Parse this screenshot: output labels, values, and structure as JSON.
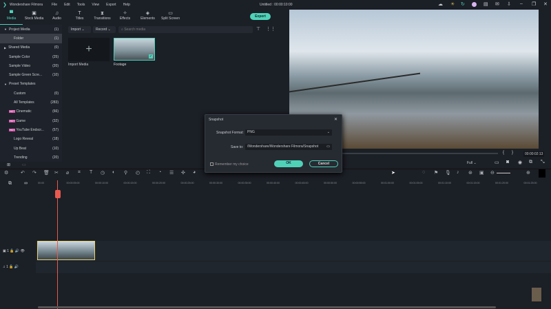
{
  "app": {
    "title": "Wondershare Filmora",
    "menu": [
      "File",
      "Edit",
      "Tools",
      "View",
      "Export",
      "Help"
    ],
    "project": "Untitled : 00:00:10:00"
  },
  "tabs": [
    {
      "label": "Media",
      "icon": "▀"
    },
    {
      "label": "Stock Media",
      "icon": "▣"
    },
    {
      "label": "Audio",
      "icon": "♫"
    },
    {
      "label": "Titles",
      "icon": "T"
    },
    {
      "label": "Transitions",
      "icon": "⧗"
    },
    {
      "label": "Effects",
      "icon": "✧"
    },
    {
      "label": "Elements",
      "icon": "◈"
    },
    {
      "label": "Split Screen",
      "icon": "▭"
    }
  ],
  "export_label": "Export",
  "sidebar": [
    {
      "label": "Project Media",
      "count": "(1)",
      "arrow": "▼",
      "indent": 0
    },
    {
      "label": "Folder",
      "count": "(1)",
      "arrow": "",
      "indent": 2,
      "sel": true
    },
    {
      "label": "Shared Media",
      "count": "(0)",
      "arrow": "▶",
      "indent": 0
    },
    {
      "label": "Sample Color",
      "count": "(25)",
      "arrow": "",
      "indent": 1
    },
    {
      "label": "Sample Video",
      "count": "(20)",
      "arrow": "",
      "indent": 1
    },
    {
      "label": "Sample Green Scre...",
      "count": "(10)",
      "arrow": "",
      "indent": 1
    },
    {
      "label": "Preset Templates",
      "count": "",
      "arrow": "▼",
      "indent": 0
    },
    {
      "label": "Custom",
      "count": "(0)",
      "arrow": "",
      "indent": 2
    },
    {
      "label": "All Templates",
      "count": "(283)",
      "arrow": "",
      "indent": 2
    },
    {
      "label": "Cinematic",
      "count": "(66)",
      "arrow": "",
      "indent": 1,
      "hot": true
    },
    {
      "label": "Game",
      "count": "(32)",
      "arrow": "",
      "indent": 1,
      "hot": true
    },
    {
      "label": "YouTube Endscr...",
      "count": "(57)",
      "arrow": "",
      "indent": 1,
      "hot": true
    },
    {
      "label": "Logo Reveal",
      "count": "(18)",
      "arrow": "",
      "indent": 2
    },
    {
      "label": "Up Beat",
      "count": "(10)",
      "arrow": "",
      "indent": 2
    },
    {
      "label": "Trending",
      "count": "(20)",
      "arrow": "",
      "indent": 2
    }
  ],
  "hot_label": "HOT",
  "media": {
    "import": "Import",
    "record": "Record",
    "search_placeholder": "Search media",
    "import_media": "Import Media",
    "footage": "Footage"
  },
  "player": {
    "timecode": "00:00:02:13",
    "quality": "Full",
    "progress": 0.06
  },
  "dialog": {
    "title": "Snapshot",
    "format_label": "Snapshot Format:",
    "format_value": "PNG",
    "save_label": "Save to:",
    "save_value": "/Wondershare/Wondershare Filmora/Snapshot",
    "remember": "Remember my choice",
    "ok": "OK",
    "cancel": "Cancel"
  },
  "ruler": [
    "00:00",
    "00:00:05:00",
    "00:00:10:00",
    "00:00:15:00",
    "00:00:20:00",
    "00:00:25:00",
    "00:00:30:00",
    "00:00:35:00",
    "00:00:40:00",
    "00:00:45:00",
    "00:00:50:00",
    "00:00:55:00",
    "00:01:00:00",
    "00:01:05:00",
    "00:01:10:00",
    "00:01:15:00",
    "00:01:20:00",
    "00:01:25:00"
  ],
  "tracks": {
    "video": "1",
    "audio": "1"
  },
  "accent": "#4fd1b8"
}
